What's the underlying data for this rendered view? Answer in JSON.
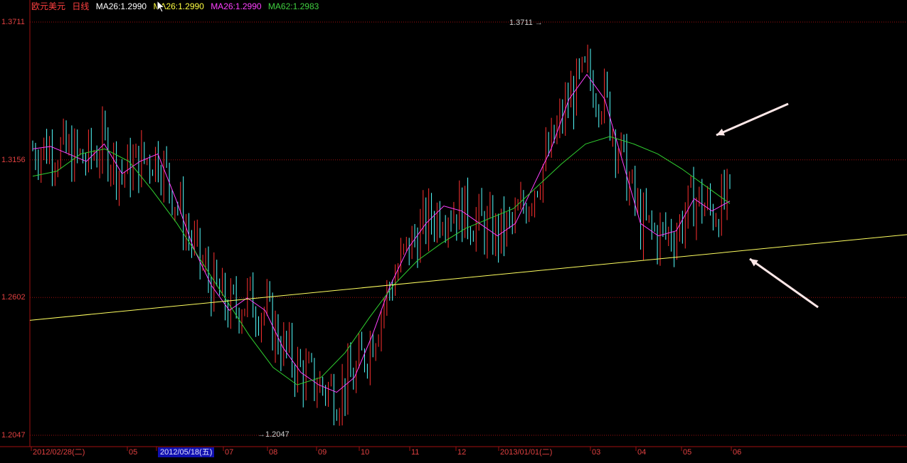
{
  "legend": {
    "symbol": "欧元美元",
    "period": "日线",
    "ma1": "MA26:1.2990",
    "ma2": "MA26:1.2990",
    "ma3": "MA26:1.2990",
    "ma4": "MA62:1.2983"
  },
  "colors": {
    "up": "#ff3030",
    "down": "#54ffff",
    "ma_a": "#ff40ff",
    "ma_b": "#30d030",
    "trendline": "#ffff60",
    "grid": "#a01010",
    "arrow": "#ffe8e8"
  },
  "peak_labels": {
    "high": "1.3711",
    "low": "1.2047"
  },
  "chart_data": {
    "type": "candlestick",
    "y_ticks": [
      "1.3711",
      "1.3156",
      "1.2602",
      "1.2047"
    ],
    "ylim": [
      1.2047,
      1.3711
    ],
    "x_labels": [
      "2012/02/28(二)",
      "05",
      "2012/05/18(五)",
      "07",
      "08",
      "09",
      "10",
      "11",
      "12",
      "2013/01/01(二)",
      "03",
      "04",
      "05",
      "06"
    ],
    "highlighted_x_label": "2012/05/18(五)",
    "high": 1.3711,
    "low": 1.2047,
    "ma_close_path": [
      1.32,
      1.321,
      1.318,
      1.315,
      1.322,
      1.31,
      1.315,
      1.318,
      1.3,
      1.28,
      1.265,
      1.255,
      1.26,
      1.255,
      1.24,
      1.23,
      1.225,
      1.222,
      1.228,
      1.245,
      1.265,
      1.28,
      1.29,
      1.297,
      1.295,
      1.29,
      1.285,
      1.29,
      1.305,
      1.32,
      1.34,
      1.35,
      1.34,
      1.315,
      1.29,
      1.285,
      1.287,
      1.3,
      1.295,
      1.299
    ],
    "ma_slow_path": [
      1.309,
      1.311,
      1.318,
      1.32,
      1.315,
      1.303,
      1.29,
      1.275,
      1.26,
      1.245,
      1.232,
      1.225,
      1.228,
      1.238,
      1.252,
      1.265,
      1.275,
      1.282,
      1.288,
      1.292,
      1.296,
      1.305,
      1.314,
      1.322,
      1.325,
      1.322,
      1.318,
      1.312,
      1.305,
      1.298
    ],
    "trendline": {
      "start": 1.251,
      "end": 1.2855
    },
    "grid": "on"
  }
}
